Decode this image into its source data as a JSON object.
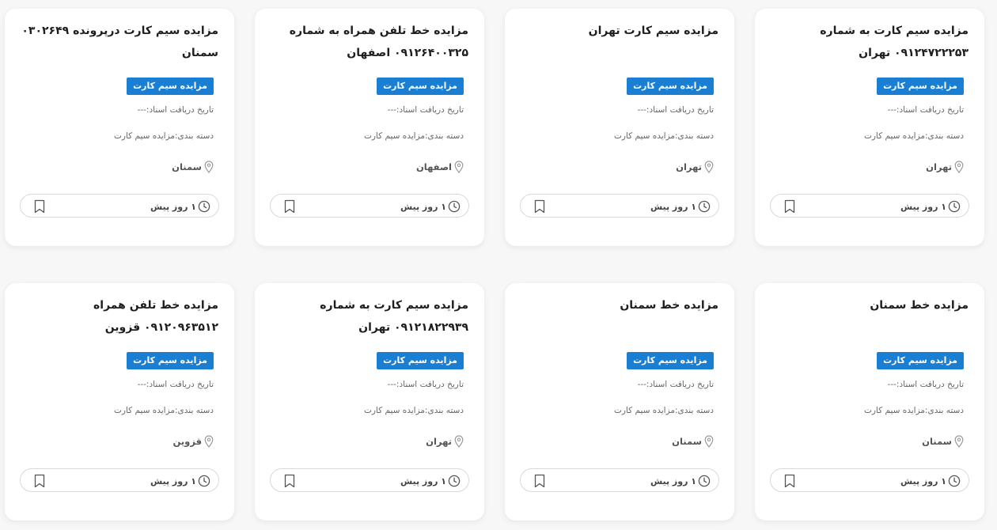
{
  "cards": [
    {
      "title": "مزایده سیم کارت به شماره ۰۹۱۲۴۷۲۲۲۵۳ تهران",
      "badge": "مزایده سیم کارت",
      "docs": "تاریخ دریافت اسناد:---",
      "category": "دسته بندی:مزایده سیم کارت",
      "city": "تهران",
      "time": "۱ روز پیش"
    },
    {
      "title": "مزایده سیم کارت تهران",
      "badge": "مزایده سیم کارت",
      "docs": "تاریخ دریافت اسناد:---",
      "category": "دسته بندی:مزایده سیم کارت",
      "city": "تهران",
      "time": "۱ روز پیش"
    },
    {
      "title": "مزایده خط تلفن همراه به شماره ۰۹۱۲۶۴۰۰۳۲۵ اصفهان",
      "badge": "مزایده سیم کارت",
      "docs": "تاریخ دریافت اسناد:---",
      "category": "دسته بندی:مزایده سیم کارت",
      "city": "اصفهان",
      "time": "۱ روز پیش"
    },
    {
      "title": "مزایده سیم کارت درپرونده ۰۳۰۲۶۴۹ سمنان",
      "badge": "مزایده سیم کارت",
      "docs": "تاریخ دریافت اسناد:---",
      "category": "دسته بندی:مزایده سیم کارت",
      "city": "سمنان",
      "time": "۱ روز پیش"
    },
    {
      "title": "مزایده خط سمنان",
      "badge": "مزایده سیم کارت",
      "docs": "تاریخ دریافت اسناد:---",
      "category": "دسته بندی:مزایده سیم کارت",
      "city": "سمنان",
      "time": "۱ روز پیش"
    },
    {
      "title": "مزایده خط سمنان",
      "badge": "مزایده سیم کارت",
      "docs": "تاریخ دریافت اسناد:---",
      "category": "دسته بندی:مزایده سیم کارت",
      "city": "سمنان",
      "time": "۱ روز پیش"
    },
    {
      "title": "مزایده سیم کارت به شماره ۰۹۱۲۱۸۲۲۹۳۹ تهران",
      "badge": "مزایده سیم کارت",
      "docs": "تاریخ دریافت اسناد:---",
      "category": "دسته بندی:مزایده سیم کارت",
      "city": "تهران",
      "time": "۱ روز پیش"
    },
    {
      "title": "مزایده خط تلفن همراه ۰۹۱۲۰۹۶۳۵۱۲ قزوین",
      "badge": "مزایده سیم کارت",
      "docs": "تاریخ دریافت اسناد:---",
      "category": "دسته بندی:مزایده سیم کارت",
      "city": "قزوین",
      "time": "۱ روز پیش"
    }
  ]
}
